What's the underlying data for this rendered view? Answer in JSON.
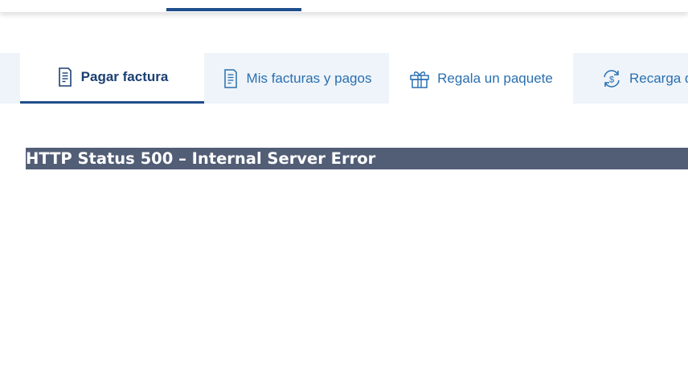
{
  "tabs": [
    {
      "label": "Pagar factura",
      "icon": "bill-icon",
      "active": true
    },
    {
      "label": "Mis facturas y pagos",
      "icon": "bill-icon",
      "active": false
    },
    {
      "label": "Regala un paquete",
      "icon": "gift-icon",
      "active": false
    },
    {
      "label": "Recarga de",
      "icon": "recharge-dollar-icon",
      "active": false
    }
  ],
  "error": {
    "title": "HTTP Status 500 – Internal Server Error"
  },
  "colors": {
    "accent": "#1f4e8c",
    "tab_text": "#2a6fb0",
    "tab_bg": "#eef4f9",
    "error_bar": "#525d76"
  }
}
